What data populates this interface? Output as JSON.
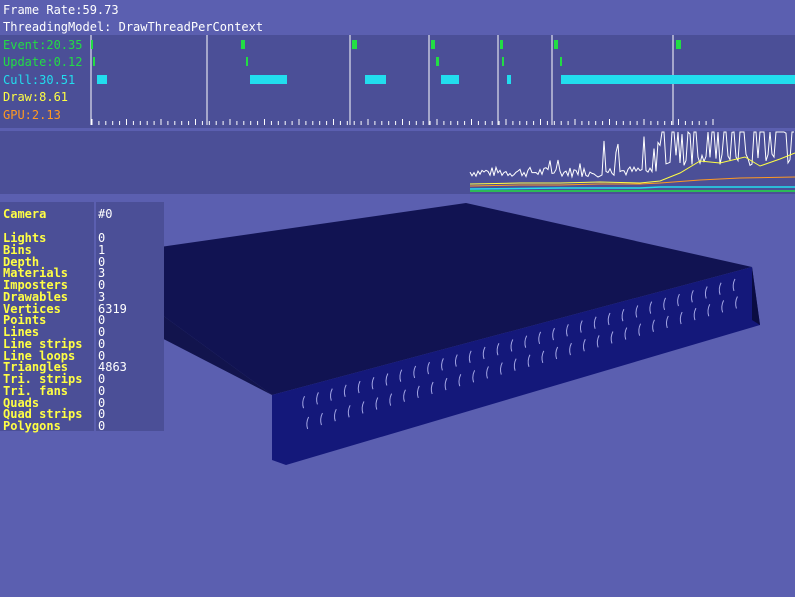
{
  "header": {
    "frame_rate": "Frame Rate:59.73",
    "threading_model": "ThreadingModel: DrawThreadPerContext"
  },
  "timing": {
    "rows": [
      {
        "label": "Event:20.35",
        "color": "#22dd44"
      },
      {
        "label": "Update:0.12",
        "color": "#22dd44"
      },
      {
        "label": "Cull:30.51",
        "color": "#22ddee"
      },
      {
        "label": "Draw:8.61",
        "color": "#ffff44"
      },
      {
        "label": "GPU:2.13",
        "color": "#ff9922"
      }
    ]
  },
  "stats": {
    "camera_label": "Camera",
    "camera_value": "#0",
    "rows": [
      {
        "label": "Lights",
        "value": "0"
      },
      {
        "label": "Bins",
        "value": "1"
      },
      {
        "label": "Depth",
        "value": "0"
      },
      {
        "label": "Materials",
        "value": "3"
      },
      {
        "label": "Imposters",
        "value": "0"
      },
      {
        "label": "Drawables",
        "value": "3"
      },
      {
        "label": "Vertices",
        "value": "6319"
      },
      {
        "label": "Points",
        "value": "0"
      },
      {
        "label": "Lines",
        "value": "0"
      },
      {
        "label": "Line strips",
        "value": "0"
      },
      {
        "label": "Line loops",
        "value": "0"
      },
      {
        "label": "Triangles",
        "value": "4863"
      },
      {
        "label": "Tri. strips",
        "value": "0"
      },
      {
        "label": "Tri. fans",
        "value": "0"
      },
      {
        "label": "Quads",
        "value": "0"
      },
      {
        "label": "Quad strips",
        "value": "0"
      },
      {
        "label": "Polygons",
        "value": "0"
      }
    ]
  },
  "colors": {
    "background": "#5b5fb0",
    "panel": "#4b4f97",
    "model": "#0b0d4a",
    "model_front": "#15197a"
  }
}
